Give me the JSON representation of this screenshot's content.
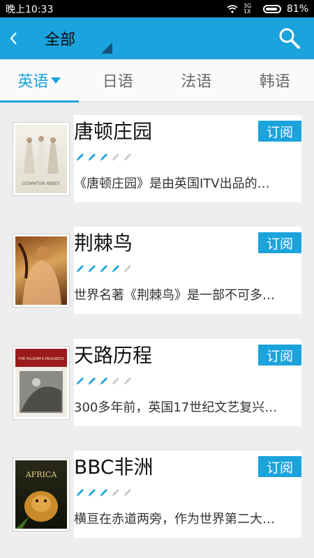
{
  "status_bar": {
    "time": "晚上10:33",
    "network": "3G 1X",
    "battery": "81%"
  },
  "app_bar": {
    "title": "全部"
  },
  "tabs": [
    {
      "label": "英语",
      "active": true
    },
    {
      "label": "日语",
      "active": false
    },
    {
      "label": "法语",
      "active": false
    },
    {
      "label": "韩语",
      "active": false
    }
  ],
  "books": [
    {
      "title": "唐顿庄园",
      "button": "订阅",
      "rating": 3,
      "rating_max": 5,
      "description": "《唐顿庄园》是由英国ITV出品的…",
      "cover_text": "DOWNTON ABBEY"
    },
    {
      "title": "荆棘鸟",
      "button": "订阅",
      "rating": 4,
      "rating_max": 5,
      "description": "世界名著《荆棘鸟》是一部不可多…"
    },
    {
      "title": "天路历程",
      "button": "订阅",
      "rating": 3,
      "rating_max": 5,
      "description": "300多年前，英国17世纪文艺复兴…",
      "cover_text": "THE PILGRIM'S PROGRESS"
    },
    {
      "title": "BBC非洲",
      "button": "订阅",
      "rating": 3,
      "rating_max": 5,
      "description": "横亘在赤道两旁，作为世界第二大…",
      "cover_text": "AFRICA"
    }
  ],
  "colors": {
    "accent": "#1aa3dc",
    "rating_filled": "#1aa3dc",
    "rating_empty": "#c8c8c8"
  }
}
